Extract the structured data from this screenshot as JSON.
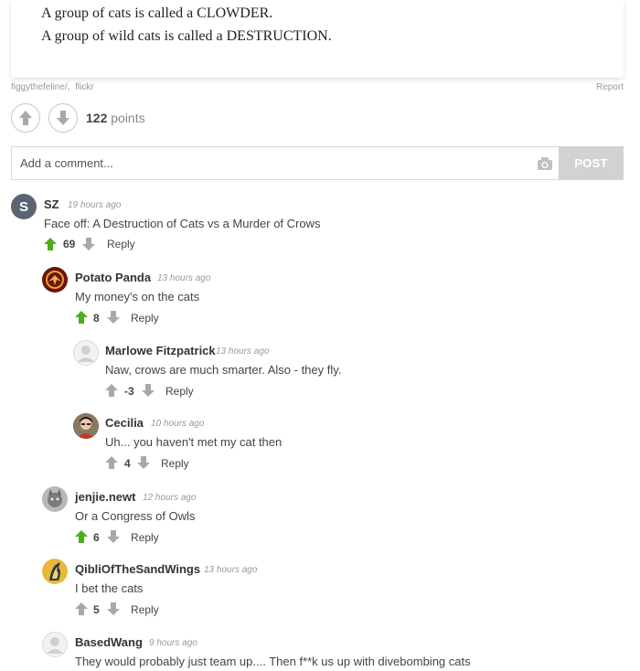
{
  "post": {
    "lines": [
      "A group of cats is called a CLOWDER.",
      "A group of wild cats is called a DESTRUCTION."
    ],
    "source_user": "figgythefeline/",
    "source_sep": ",",
    "source_site": "flickr",
    "report_label": "Report",
    "points_value": "122",
    "points_label": "points"
  },
  "comment_form": {
    "placeholder": "Add a comment...",
    "post_label": "POST"
  },
  "comments": [
    {
      "user": "SZ",
      "time": "19 hours ago",
      "text": "Face off: A Destruction of Cats vs a Murder of Crows",
      "score": "69",
      "reply": "Reply",
      "avatar_letter": "S"
    },
    {
      "user": "Potato Panda",
      "time": "13 hours ago",
      "text": "My money's on the cats",
      "score": "8",
      "reply": "Reply"
    },
    {
      "user": "Marlowe Fitzpatrick",
      "time": "13 hours ago",
      "text": "Naw, crows are much smarter. Also - they fly.",
      "score": "-3",
      "reply": "Reply"
    },
    {
      "user": "Cecilia",
      "time": "10 hours ago",
      "text": "Uh... you haven't met my cat then",
      "score": "4",
      "reply": "Reply"
    },
    {
      "user": "jenjie.newt",
      "time": "12 hours ago",
      "text": "Or a Congress of Owls",
      "score": "6",
      "reply": "Reply"
    },
    {
      "user": "QibliOfTheSandWings",
      "time": "13 hours ago",
      "text": "I bet the cats",
      "score": "5",
      "reply": "Reply"
    },
    {
      "user": "BasedWang",
      "time": "9 hours ago",
      "text": "They would probably just team up.... Then f**k us up with divebombing cats"
    }
  ],
  "colors": {
    "upvote_active": "#4caf1a",
    "vote_gray": "#a8a8a8",
    "sz_avatar": "#5a6472"
  }
}
